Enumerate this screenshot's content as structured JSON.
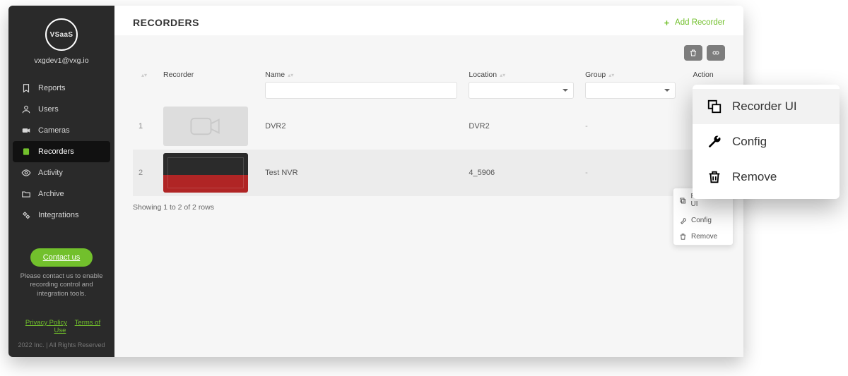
{
  "brand": "VSaaS",
  "user_email": "vxgdev1@vxg.io",
  "nav": [
    {
      "label": "Reports",
      "icon": "bookmark"
    },
    {
      "label": "Users",
      "icon": "user"
    },
    {
      "label": "Cameras",
      "icon": "camera"
    },
    {
      "label": "Recorders",
      "icon": "recorder",
      "active": true
    },
    {
      "label": "Activity",
      "icon": "eye"
    },
    {
      "label": "Archive",
      "icon": "folder"
    },
    {
      "label": "Integrations",
      "icon": "gears"
    }
  ],
  "contact": {
    "button": "Contact us",
    "text": "Please contact us to enable recording control and integration tools."
  },
  "legal": {
    "privacy": "Privacy Policy",
    "terms": "Terms of Use"
  },
  "copyright": "2022 Inc. | All Rights Reserved",
  "page": {
    "title": "RECORDERS",
    "add_button": "Add Recorder"
  },
  "columns": {
    "recorder": "Recorder",
    "name": "Name",
    "location": "Location",
    "group": "Group",
    "action": "Action"
  },
  "filters": {
    "name": "",
    "location": "",
    "group": ""
  },
  "rows": [
    {
      "idx": "1",
      "thumb": "camera-icon",
      "name": "DVR2",
      "location": "DVR2",
      "group": "-"
    },
    {
      "idx": "2",
      "thumb": "snapshot",
      "name": "Test NVR",
      "location": "4_5906",
      "group": "-"
    }
  ],
  "pager": "Showing 1 to 2 of 2 rows",
  "row_menu": {
    "recorder_ui": "Recorder UI",
    "config": "Config",
    "remove": "Remove"
  },
  "big_menu": {
    "recorder_ui": "Recorder UI",
    "config": "Config",
    "remove": "Remove"
  }
}
